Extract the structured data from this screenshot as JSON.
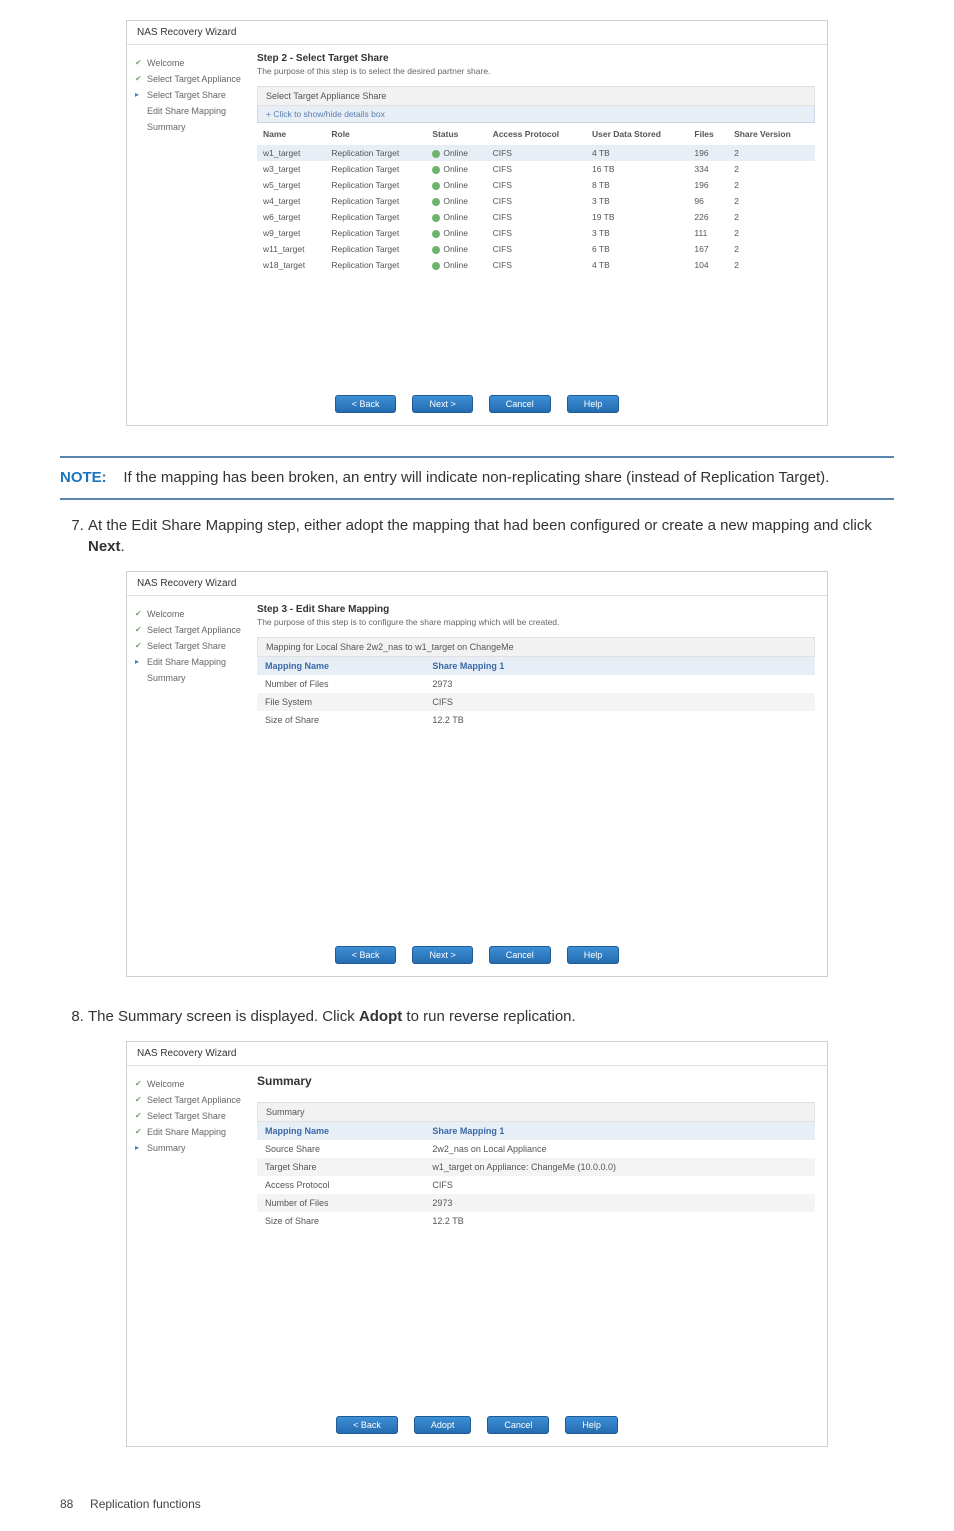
{
  "wizard1": {
    "window_title": "NAS Recovery Wizard",
    "sidebar": [
      "Welcome",
      "Select Target Appliance",
      "Select Target Share",
      "Edit Share Mapping",
      "Summary"
    ],
    "title": "Step 2 - Select Target Share",
    "desc": "The purpose of this step is to select the desired partner share.",
    "panel_label": "Select Target Appliance Share",
    "expand_label": "+ Click to show/hide details box",
    "cols": [
      "Name",
      "Role",
      "Status",
      "Access Protocol",
      "User Data Stored",
      "Files",
      "Share Version"
    ],
    "rows": [
      {
        "name": "w1_target",
        "role": "Replication Target",
        "status": "Online",
        "proto": "CIFS",
        "stored": "4 TB",
        "files": "196",
        "ver": "2",
        "sel": true
      },
      {
        "name": "w3_target",
        "role": "Replication Target",
        "status": "Online",
        "proto": "CIFS",
        "stored": "16 TB",
        "files": "334",
        "ver": "2"
      },
      {
        "name": "w5_target",
        "role": "Replication Target",
        "status": "Online",
        "proto": "CIFS",
        "stored": "8 TB",
        "files": "196",
        "ver": "2"
      },
      {
        "name": "w4_target",
        "role": "Replication Target",
        "status": "Online",
        "proto": "CIFS",
        "stored": "3 TB",
        "files": "96",
        "ver": "2"
      },
      {
        "name": "w6_target",
        "role": "Replication Target",
        "status": "Online",
        "proto": "CIFS",
        "stored": "19 TB",
        "files": "226",
        "ver": "2"
      },
      {
        "name": "w9_target",
        "role": "Replication Target",
        "status": "Online",
        "proto": "CIFS",
        "stored": "3 TB",
        "files": "111",
        "ver": "2"
      },
      {
        "name": "w11_target",
        "role": "Replication Target",
        "status": "Online",
        "proto": "CIFS",
        "stored": "6 TB",
        "files": "167",
        "ver": "2"
      },
      {
        "name": "w18_target",
        "role": "Replication Target",
        "status": "Online",
        "proto": "CIFS",
        "stored": "4 TB",
        "files": "104",
        "ver": "2"
      }
    ],
    "buttons": {
      "back": "< Back",
      "next": "Next >",
      "cancel": "Cancel",
      "help": "Help"
    }
  },
  "note_label": "NOTE:",
  "note_text": "If the mapping has been broken, an entry will indicate non-replicating share (instead of Replication Target).",
  "step7_pre": "At the Edit Share Mapping step, either adopt the mapping that had been configured or create a new mapping and click ",
  "step7_bold": "Next",
  "step7_post": ".",
  "wizard2": {
    "window_title": "NAS Recovery Wizard",
    "sidebar": [
      "Welcome",
      "Select Target Appliance",
      "Select Target Share",
      "Edit Share Mapping",
      "Summary"
    ],
    "title": "Step 3 - Edit Share Mapping",
    "desc": "The purpose of this step is to configure the share mapping which will be created.",
    "panel_label": "Mapping for Local Share 2w2_nas to w1_target on ChangeMe",
    "kv": [
      {
        "k": "Mapping Name",
        "v": "Share Mapping 1",
        "hi": true
      },
      {
        "k": "Number of Files",
        "v": "2973"
      },
      {
        "k": "File System",
        "v": "CIFS"
      },
      {
        "k": "Size of Share",
        "v": "12.2 TB"
      }
    ],
    "buttons": {
      "back": "< Back",
      "next": "Next >",
      "cancel": "Cancel",
      "help": "Help"
    }
  },
  "step8_pre": "The Summary screen is displayed. Click ",
  "step8_bold": "Adopt",
  "step8_post": " to run reverse replication.",
  "wizard3": {
    "window_title": "NAS Recovery Wizard",
    "sidebar": [
      "Welcome",
      "Select Target Appliance",
      "Select Target Share",
      "Edit Share Mapping",
      "Summary"
    ],
    "title": "Summary",
    "panel_label": "Summary",
    "kv": [
      {
        "k": "Mapping Name",
        "v": "Share Mapping 1",
        "hi": true
      },
      {
        "k": "Source Share",
        "v": "2w2_nas on Local Appliance"
      },
      {
        "k": "Target Share",
        "v": "w1_target on Appliance: ChangeMe (10.0.0.0)"
      },
      {
        "k": "Access Protocol",
        "v": "CIFS"
      },
      {
        "k": "Number of Files",
        "v": "2973"
      },
      {
        "k": "Size of Share",
        "v": "12.2 TB"
      }
    ],
    "buttons": {
      "back": "< Back",
      "adopt": "Adopt",
      "cancel": "Cancel",
      "help": "Help"
    }
  },
  "footer_page": "88",
  "footer_text": "Replication functions"
}
